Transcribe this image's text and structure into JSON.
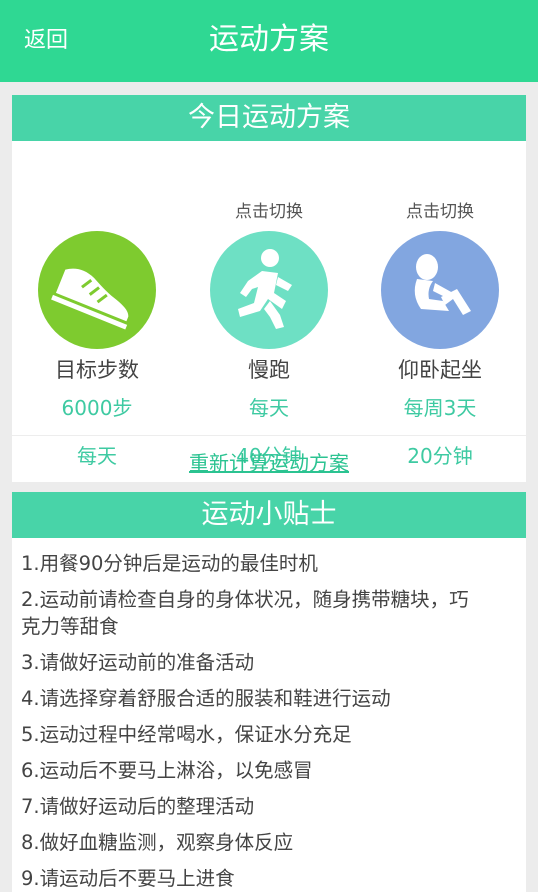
{
  "header": {
    "back_label": "返回",
    "title": "运动方案"
  },
  "plan": {
    "heading": "今日运动方案",
    "items": [
      {
        "switch_hint": "",
        "name": "目标步数",
        "value1": "6000步",
        "value2": "每天",
        "icon": "sneaker-icon",
        "color": "#7ecb2f"
      },
      {
        "switch_hint": "点击切换",
        "name": "慢跑",
        "value1": "每天",
        "value2": "40分钟",
        "icon": "running-icon",
        "color": "#6ee0c4"
      },
      {
        "switch_hint": "点击切换",
        "name": "仰卧起坐",
        "value1": "每周3天",
        "value2": "20分钟",
        "icon": "sit-up-icon",
        "color": "#82a6e0"
      }
    ],
    "recalc_label": "重新计算运动方案"
  },
  "tips": {
    "heading": "运动小贴士",
    "items": [
      "1.用餐90分钟后是运动的最佳时机",
      "2.运动前请检查自身的身体状况，随身携带糖块，巧克力等甜食",
      "3.请做好运动前的准备活动",
      "4.请选择穿着舒服合适的服装和鞋进行运动",
      "5.运动过程中经常喝水，保证水分充足",
      "6.运动后不要马上淋浴，以免感冒",
      "7.请做好运动后的整理活动",
      "8.做好血糖监测，观察身体反应",
      "9.请运动后不要马上进食"
    ]
  }
}
